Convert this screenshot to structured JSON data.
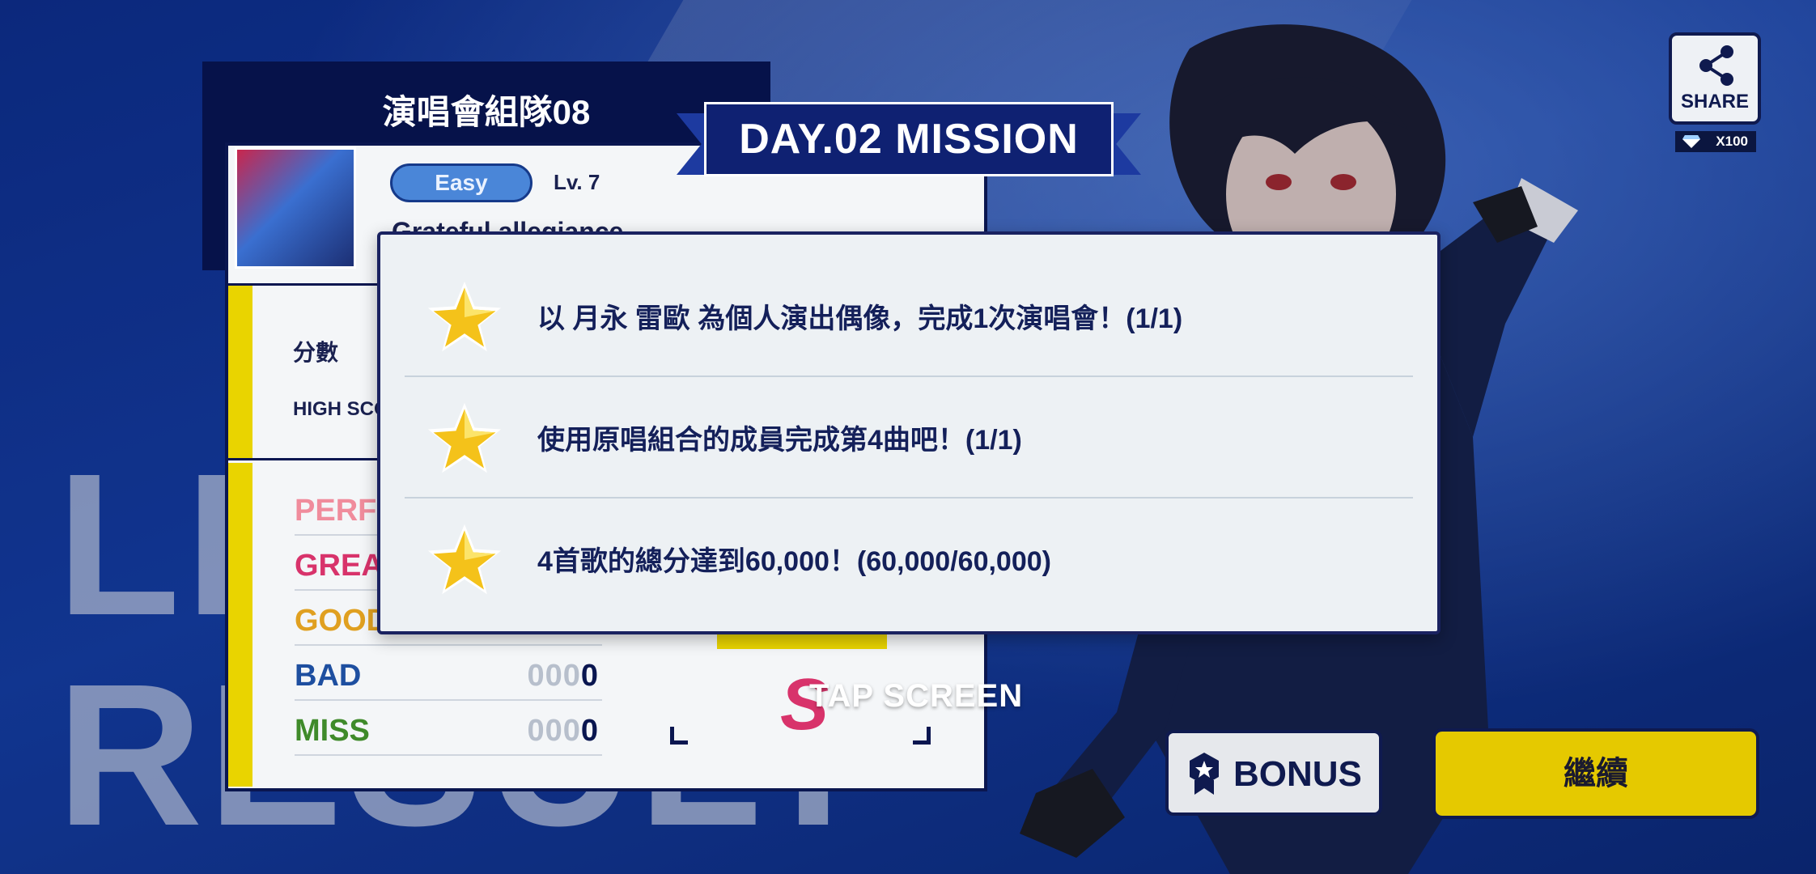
{
  "background": {
    "big_text_line1": "LI",
    "big_text_line2": "RESULT"
  },
  "result_panel": {
    "unit_name": "演唱會組隊08",
    "difficulty": "Easy",
    "level": "Lv. 7",
    "song_title": "Grateful allegiance",
    "score_label": "分數",
    "high_score_label": "HIGH SCORE",
    "judgements": [
      {
        "label": "PERFECT",
        "value": "",
        "color": "#f08c9c"
      },
      {
        "label": "GREAT",
        "value": "",
        "color": "#d8336b"
      },
      {
        "label": "GOOD",
        "value": "",
        "color": "#e0a020"
      },
      {
        "label": "BAD",
        "value_dim": "000",
        "value_main": "0",
        "color": "#1e4fa0"
      },
      {
        "label": "MISS",
        "value_dim": "000",
        "value_main": "0",
        "color": "#3f8a2a"
      }
    ],
    "rank": "S"
  },
  "tap_screen": "TAP SCREEN",
  "mission": {
    "banner": "DAY.02 MISSION",
    "items": [
      {
        "text": "以 月永 雷歐 為個人演出偶像，完成1次演唱會！(1/1)",
        "star": "star-icon"
      },
      {
        "text": "使用原唱組合的成員完成第4曲吧！(1/1)",
        "star": "star-icon"
      },
      {
        "text": "4首歌的總分達到60,000！(60,000/60,000)",
        "star": "star-icon"
      }
    ]
  },
  "share": {
    "label": "SHARE",
    "reward": "X100",
    "icon": "share-icon"
  },
  "buttons": {
    "bonus": "BONUS",
    "continue": "繼續"
  },
  "colors": {
    "accent_yellow": "#e5c900",
    "navy": "#0f1a4f",
    "modal_bg": "#edf1f4"
  }
}
